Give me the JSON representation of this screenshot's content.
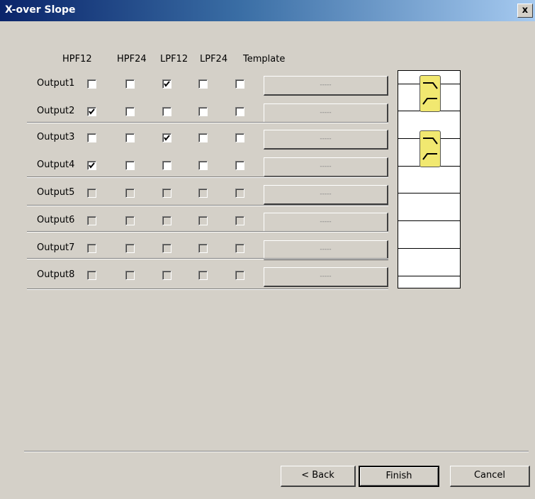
{
  "window": {
    "title": "X-over Slope",
    "close": "x"
  },
  "columns": [
    "HPF12",
    "HPF24",
    "LPF12",
    "LPF24",
    "Template"
  ],
  "outputs": [
    {
      "label": "Output1",
      "checks": [
        false,
        false,
        true,
        false,
        false
      ],
      "enabled": true,
      "template": "-----"
    },
    {
      "label": "Output2",
      "checks": [
        true,
        false,
        false,
        false,
        false
      ],
      "enabled": true,
      "template": "-----"
    },
    {
      "label": "Output3",
      "checks": [
        false,
        false,
        true,
        false,
        false
      ],
      "enabled": true,
      "template": "-----"
    },
    {
      "label": "Output4",
      "checks": [
        true,
        false,
        false,
        false,
        false
      ],
      "enabled": true,
      "template": "-----"
    },
    {
      "label": "Output5",
      "checks": [
        false,
        false,
        false,
        false,
        false
      ],
      "enabled": false,
      "template": "-----"
    },
    {
      "label": "Output6",
      "checks": [
        false,
        false,
        false,
        false,
        false
      ],
      "enabled": false,
      "template": "-----"
    },
    {
      "label": "Output7",
      "checks": [
        false,
        false,
        false,
        false,
        false
      ],
      "enabled": false,
      "template": "-----"
    },
    {
      "label": "Output8",
      "checks": [
        false,
        false,
        false,
        false,
        false
      ],
      "enabled": false,
      "template": "-----"
    }
  ],
  "routing_filters": [
    "lowpass-highpass-filter-icon",
    "lowpass-highpass-filter-icon"
  ],
  "buttons": {
    "back": "< Back",
    "finish": "Finish",
    "cancel": "Cancel"
  },
  "colors": {
    "filter_fill": "#f1e870",
    "title_bar": "#0a246a"
  }
}
